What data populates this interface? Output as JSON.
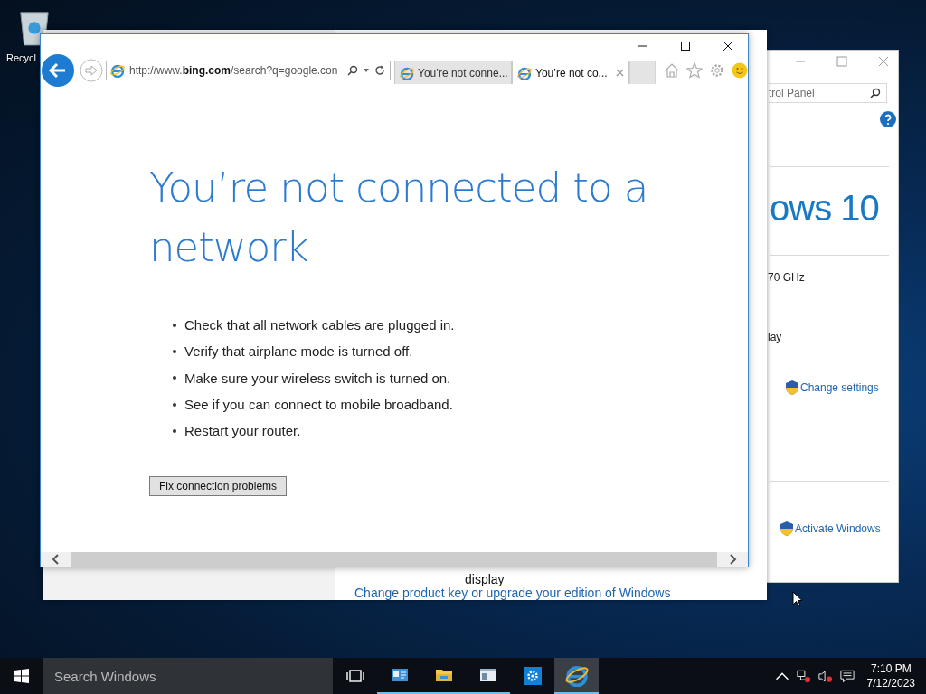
{
  "desktop": {
    "icons": [
      {
        "label": "Recycl"
      }
    ]
  },
  "system_window": {
    "search": {
      "placeholder": "trol Panel"
    },
    "edition": "ows 10",
    "lines": [
      "70 GHz",
      "lay"
    ],
    "links": [
      "Change settings",
      "Activate Windows"
    ]
  },
  "control_panel_window": {
    "text": "display",
    "link": "Change product key or upgrade your edition of Windows"
  },
  "browser": {
    "address": "http://www.**bing.com**/search?q=google.con",
    "tabs": [
      {
        "title": "You’re not conne...",
        "selected": false
      },
      {
        "title": "You’re not co...",
        "selected": true
      }
    ],
    "page": {
      "heading": "You’re not connected to a network",
      "tips": [
        "Check that all network cables are plugged in.",
        "Verify that airplane mode is turned off.",
        "Make sure your wireless switch is turned on.",
        "See if you can connect to mobile broadband.",
        "Restart your router."
      ],
      "button": "Fix connection problems"
    }
  },
  "taskbar": {
    "search": {
      "placeholder": "Search Windows"
    },
    "apps": [
      {
        "kind": "taskview",
        "running": false,
        "selected": false
      },
      {
        "kind": "controlpanel",
        "running": true,
        "selected": false
      },
      {
        "kind": "explorer",
        "running": true,
        "selected": false
      },
      {
        "kind": "window",
        "running": true,
        "selected": false
      },
      {
        "kind": "settings",
        "running": false,
        "selected": false
      },
      {
        "kind": "ie",
        "running": true,
        "selected": true
      }
    ],
    "time": "7:10 PM",
    "date": "7/12/2023"
  }
}
